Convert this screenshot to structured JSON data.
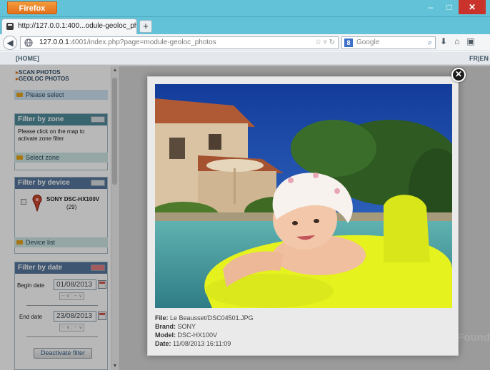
{
  "browser": {
    "menu_label": "Firefox",
    "tab_title": "http://127.0.0.1:400...odule-geoloc_photos",
    "new_tab": "+",
    "url_host": "127.0.0.1",
    "url_rest": ":4001/index.php?page=module-geoloc_photos",
    "search_placeholder": "Google",
    "win_min": "–",
    "win_max": "□",
    "win_close": "✕"
  },
  "page": {
    "home_link": "[HOME]",
    "lang": "FR|EN",
    "menu": [
      "SCAN PHOTOS",
      "GEOLOC PHOTOS"
    ],
    "please_select": "Please select",
    "zone": {
      "title": "Filter by zone",
      "text": "Please click on the map to activate zone filter",
      "select_zone": "Select zone"
    },
    "device": {
      "title": "Filter by device",
      "name": "SONY DSC-HX100V",
      "count": "(29)",
      "device_list": "Device list"
    },
    "date": {
      "title": "Filter by date",
      "begin_label": "Begin date",
      "begin_value": "01/08/2013",
      "end_label": "End date",
      "end_value": "23/08/2013",
      "time_placeholder": "-- ∨ : -- ∨",
      "deactivate": "Deactivate filter"
    },
    "bg_text": "Found"
  },
  "lightbox": {
    "close": "✕",
    "file_label": "File:",
    "file_value": "Le Beausset/DSC04501.JPG",
    "brand_label": "Brand:",
    "brand_value": "SONY",
    "model_label": "Model:",
    "model_value": "DSC-HX100V",
    "date_label": "Date:",
    "date_value": "11/08/2013 16:11:09"
  },
  "colors": {
    "chrome": "#62c3d8",
    "firefox_orange": "#e3701b",
    "panel_teal": "#4f8d9c",
    "panel_blue": "#56789e",
    "close_red": "#c9332b",
    "float_yellow": "#e6f21e"
  }
}
